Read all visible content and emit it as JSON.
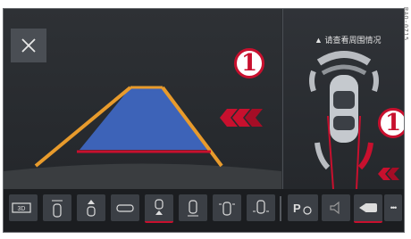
{
  "colors": {
    "accent_red": "#c8102e",
    "lane_fill": "#3d63b8",
    "lane_edge": "#e89b2c",
    "screen_bg": "#2a2d31",
    "button_bg": "#3b3f45"
  },
  "callouts": {
    "left": "1",
    "right": "1"
  },
  "right_panel": {
    "warning_text": "请查看周围情况"
  },
  "side_code": "RAO-0715",
  "toolbar": {
    "btn_3d_label": "3D",
    "btn_park_label": "P",
    "btn_more_label": "•••",
    "icons": [
      "view-3d-icon",
      "car-top-icon",
      "car-front-icon",
      "car-side-icon",
      "car-rear-hitch-icon",
      "car-rear-icon",
      "car-front-sensors-icon",
      "car-rear-sensors-icon",
      "park-assist-icon",
      "speaker-mute-icon",
      "camera-view-icon",
      "more-icon"
    ]
  }
}
